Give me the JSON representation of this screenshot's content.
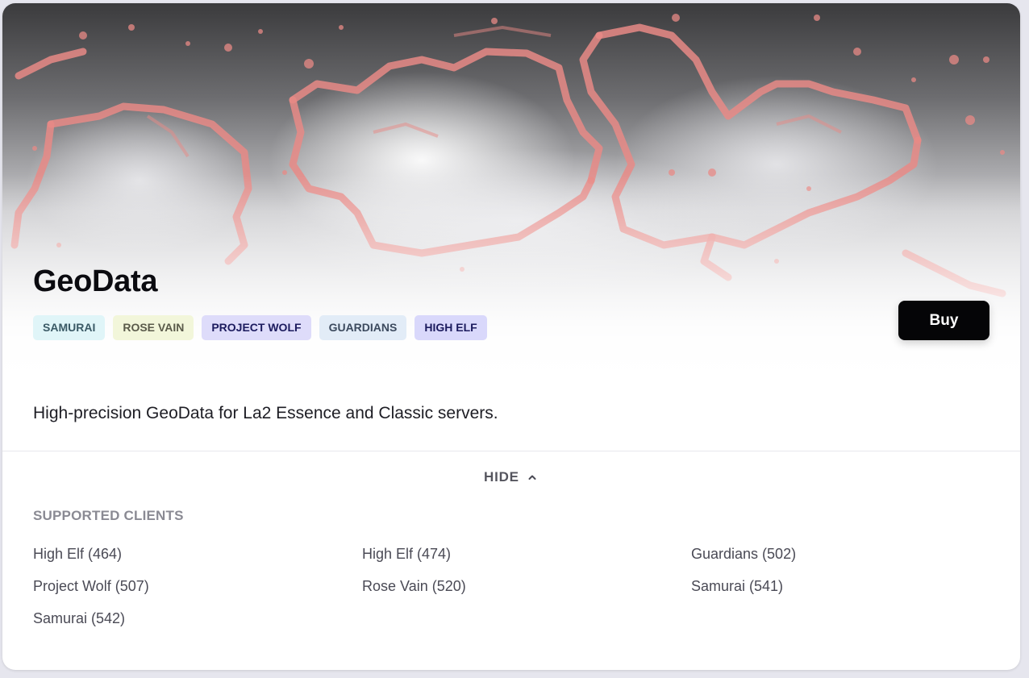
{
  "product": {
    "title": "GeoData",
    "description": "High-precision GeoData for La2 Essence and Classic servers.",
    "buy_label": "Buy",
    "hero_image": "world-geodata-map",
    "tags": [
      {
        "label": "SAMURAI",
        "bg": "#e0f5f8",
        "color": "#3b5a66"
      },
      {
        "label": "ROSE VAIN",
        "bg": "#f2f6da",
        "color": "#5a5a4a"
      },
      {
        "label": "PROJECT WOLF",
        "bg": "#dedcfa",
        "color": "#1c1b5e"
      },
      {
        "label": "GUARDIANS",
        "bg": "#e2ecf7",
        "color": "#3c4a5e"
      },
      {
        "label": "HIGH ELF",
        "bg": "#d9d8fb",
        "color": "#1c1b5e"
      }
    ]
  },
  "toggle": {
    "label": "HIDE",
    "icon": "chevron-up-icon"
  },
  "supported_clients": {
    "heading": "SUPPORTED CLIENTS",
    "items": [
      "High Elf (464)",
      "High Elf (474)",
      "Guardians (502)",
      "Project Wolf (507)",
      "Rose Vain (520)",
      "Samurai (541)",
      "Samurai (542)"
    ]
  },
  "colors": {
    "accent": "#050507",
    "map_contour": "#e88a86",
    "map_dark": "#3a3a3c"
  }
}
